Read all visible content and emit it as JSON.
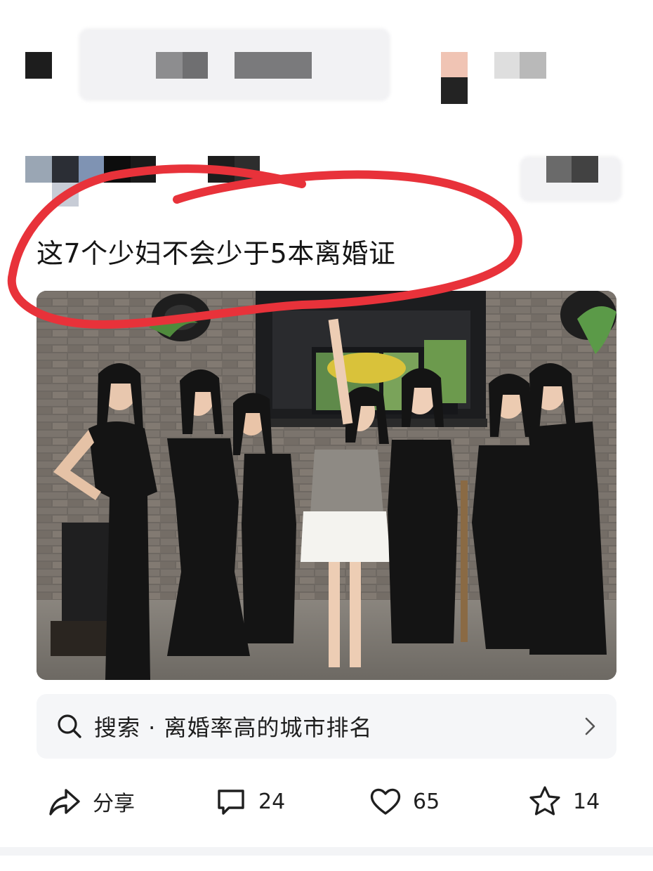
{
  "post": {
    "text": "这7个少妇不会少于5本离婚证"
  },
  "photo": {
    "description_icon": "photo-of-seven-women"
  },
  "search_suggestion": {
    "icon": "search-icon",
    "label": "搜索 · 离婚率高的城市排名",
    "chevron": "chevron-right-icon"
  },
  "actions": {
    "share": {
      "icon": "share-icon",
      "label": "分享"
    },
    "comment": {
      "icon": "comment-icon",
      "count": "24"
    },
    "like": {
      "icon": "heart-icon",
      "count": "65"
    },
    "favorite": {
      "icon": "star-icon",
      "count": "14"
    }
  },
  "colors": {
    "annotation_red": "#e8323a",
    "search_bg": "#f5f6f8",
    "text": "#151515"
  }
}
